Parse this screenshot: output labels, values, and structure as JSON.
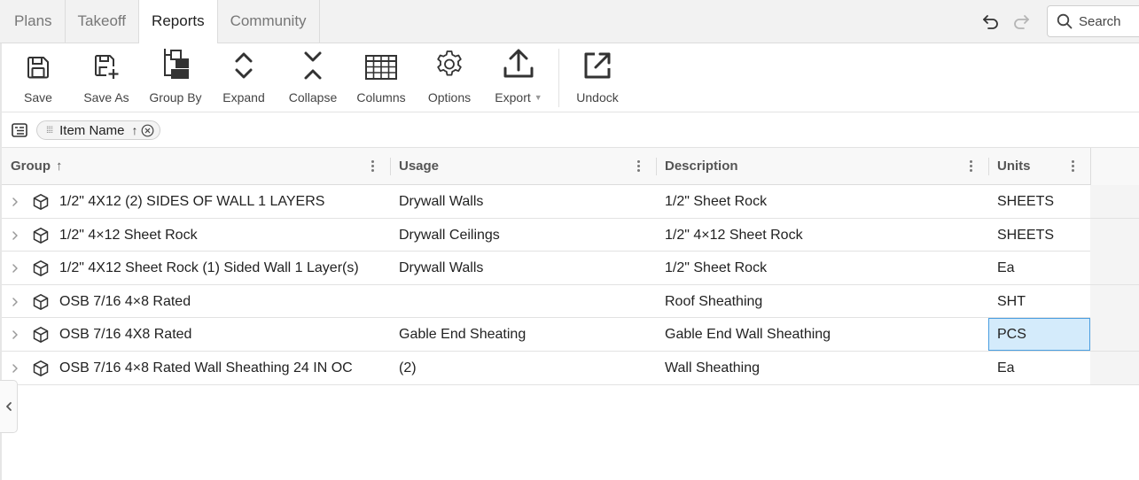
{
  "tabs": [
    {
      "label": "Plans",
      "active": false
    },
    {
      "label": "Takeoff",
      "active": false
    },
    {
      "label": "Reports",
      "active": true
    },
    {
      "label": "Community",
      "active": false
    }
  ],
  "search": {
    "placeholder": "Search",
    "icon": "search-icon"
  },
  "toolbar": {
    "save": "Save",
    "save_as": "Save As",
    "group_by": "Group By",
    "expand": "Expand",
    "collapse": "Collapse",
    "columns": "Columns",
    "options": "Options",
    "export": "Export",
    "undock": "Undock"
  },
  "group_chip": {
    "label": "Item Name",
    "sort": "↑"
  },
  "columns": {
    "group": "Group",
    "group_sort": "↑",
    "usage": "Usage",
    "description": "Description",
    "units": "Units"
  },
  "rows": [
    {
      "group": "1/2\" 4X12 (2) SIDES OF WALL 1 LAYERS",
      "usage": "Drywall Walls",
      "description": "1/2\" Sheet Rock",
      "units": "SHEETS"
    },
    {
      "group": "1/2\" 4×12 Sheet Rock",
      "usage": "Drywall Ceilings",
      "description": "1/2\" 4×12 Sheet Rock",
      "units": "SHEETS"
    },
    {
      "group": "1/2\" 4X12 Sheet Rock (1) Sided Wall 1 Layer(s)",
      "usage": "Drywall Walls",
      "description": "1/2\" Sheet Rock",
      "units": "Ea"
    },
    {
      "group": "OSB 7/16 4×8 Rated",
      "usage": "",
      "description": "Roof Sheathing",
      "units": "SHT"
    },
    {
      "group": "OSB 7/16 4X8 Rated",
      "usage": "Gable End Sheating",
      "description": "Gable End Wall Sheathing",
      "units": "PCS"
    },
    {
      "group": "OSB 7/16 4×8 Rated Wall Sheathing 24 IN OC",
      "usage": "(2)",
      "description": "Wall Sheathing",
      "units": "Ea"
    }
  ],
  "selected_cell": {
    "row": 4,
    "column": "units"
  },
  "colors": {
    "accent_selection": "#d4ebfb",
    "selection_border": "#4a9ee0",
    "toolbar_icon": "#333333"
  }
}
